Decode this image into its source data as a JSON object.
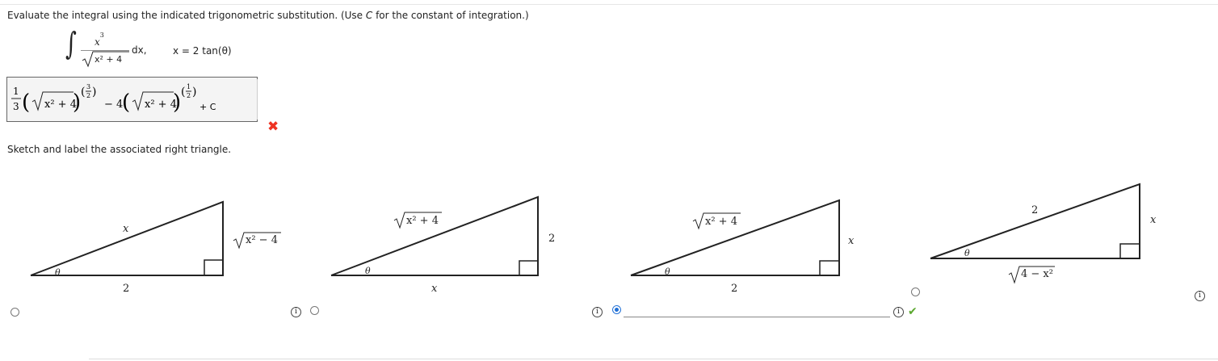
{
  "question": {
    "instruction_before": "Evaluate the integral using the indicated trigonometric substitution. (Use ",
    "instruction_var": "C",
    "instruction_after": " for the constant of integration.)",
    "integrand_num_base": "x",
    "integrand_num_exp": "3",
    "integrand_den": "x² + 4",
    "dx": "dx,",
    "substitution": "x = 2 tan(θ)"
  },
  "answer": {
    "c1_num": "1",
    "c1_den": "3",
    "radicand1": "x² + 4",
    "exp1_num": "3",
    "exp1_den": "2",
    "minus_coeff": "− 4",
    "radicand2": "x² + 4",
    "exp2_num": "1",
    "exp2_den": "2",
    "plus_c": "+ C",
    "status": "incorrect"
  },
  "prompt2": "Sketch and label the associated right triangle.",
  "triangles": [
    {
      "hyp": "x",
      "opp": "√x² − 4",
      "adj": "2",
      "angle": "θ"
    },
    {
      "hyp": "√x² + 4",
      "opp": "2",
      "adj": "x",
      "angle": "θ"
    },
    {
      "hyp": "√x² + 4",
      "opp": "x",
      "adj": "2",
      "angle": "θ"
    },
    {
      "hyp": "2",
      "opp": "x",
      "adj": "√4 − x²",
      "angle": "θ"
    }
  ],
  "info_glyph": "i",
  "check_glyph": "✔",
  "wrong_glyph": "✖",
  "colors": {
    "correct": "#5ba82f",
    "incorrect": "#e32",
    "radio_selected": "#1f6fd6"
  },
  "selected_choice": 3
}
